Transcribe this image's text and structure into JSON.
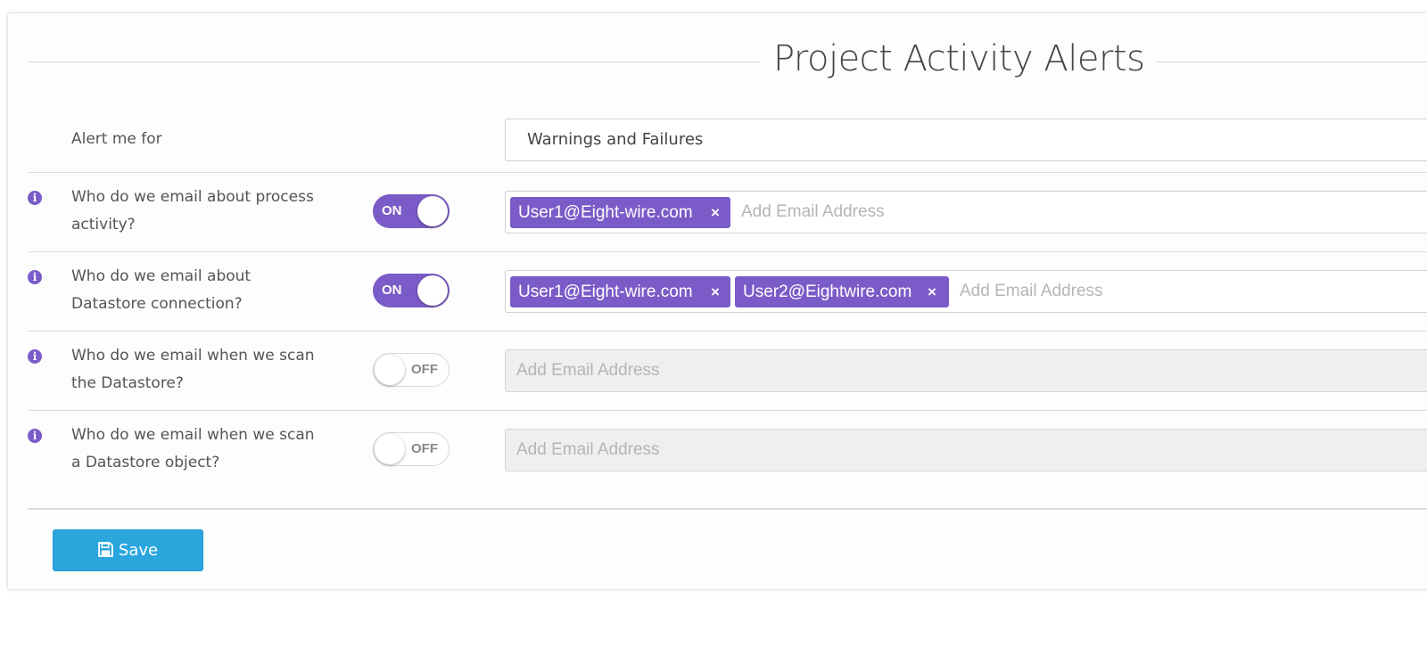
{
  "title": "Project Activity Alerts",
  "alert_row": {
    "label": "Alert me for",
    "selected": "Warnings and Failures"
  },
  "rows": [
    {
      "label_line1": "Who do we email about process",
      "label_line2": "activity?",
      "toggle_state": "ON",
      "tags": [
        "User1@Eight-wire.com"
      ],
      "placeholder": "Add Email Address"
    },
    {
      "label_line1": "Who do we email about",
      "label_line2": "Datastore connection?",
      "toggle_state": "ON",
      "tags": [
        "User1@Eight-wire.com",
        "User2@Eightwire.com"
      ],
      "placeholder": "Add Email Address"
    },
    {
      "label_line1": "Who do we email when we scan",
      "label_line2": "the Datastore?",
      "toggle_state": "OFF",
      "tags": [],
      "placeholder": "Add Email Address"
    },
    {
      "label_line1": "Who do we email when we scan",
      "label_line2": "a Datastore object?",
      "toggle_state": "OFF",
      "tags": [],
      "placeholder": "Add Email Address"
    }
  ],
  "tag_remove_glyph": "×",
  "info_glyph": "i",
  "save_label": "Save",
  "colors": {
    "accent": "#7b5bc7",
    "save_button": "#2aa6dd"
  },
  "icons": {
    "info": "info-icon",
    "remove": "close-icon",
    "save": "floppy-disk-icon"
  }
}
